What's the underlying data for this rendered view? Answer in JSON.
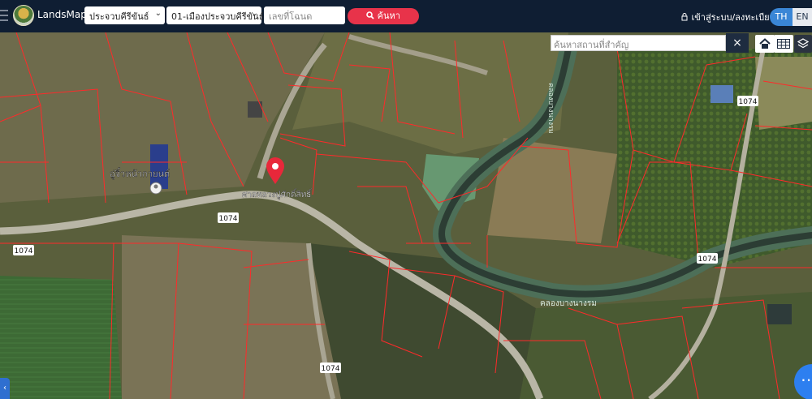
{
  "header": {
    "brand": "LandsMaps",
    "province_select": "ประจวบคีรีขันธ์",
    "district_select": "01-เมืองประจวบคีรีขันธ์",
    "deed_placeholder": "เลขที่โฉนด",
    "search_label": "ค้นหา",
    "login_label": "เข้าสู่ระบบ/ลงทะเบียน",
    "lang_th": "TH",
    "lang_en": "EN"
  },
  "map_tools": {
    "place_search_placeholder": "ค้นหาสถานที่สำคัญ",
    "clear_label": "×"
  },
  "map_labels": {
    "shop": "อู่จิ๋วหน้ากายนต์",
    "temple": "ศาลหลวงปู่ศักดิ์สิทธิ์",
    "canal_upper": "คลองบางนางรม",
    "canal_lower": "คลองบางนางรม",
    "road_1": "1074",
    "road_2": "1074",
    "road_3": "1074",
    "road_4": "1074",
    "road_5": "1074"
  },
  "icons": {
    "menu": "hamburger-icon",
    "search": "search-icon",
    "user": "user-icon",
    "home": "home-icon",
    "grid": "grid-icon",
    "layers": "layers-icon",
    "pin": "map-pin-icon",
    "more": "more-icon"
  },
  "colors": {
    "topbar": "#0f1e33",
    "accent_red": "#e8334a",
    "parcel_line": "#ff2a2a",
    "fab_blue": "#2d7ff0"
  }
}
